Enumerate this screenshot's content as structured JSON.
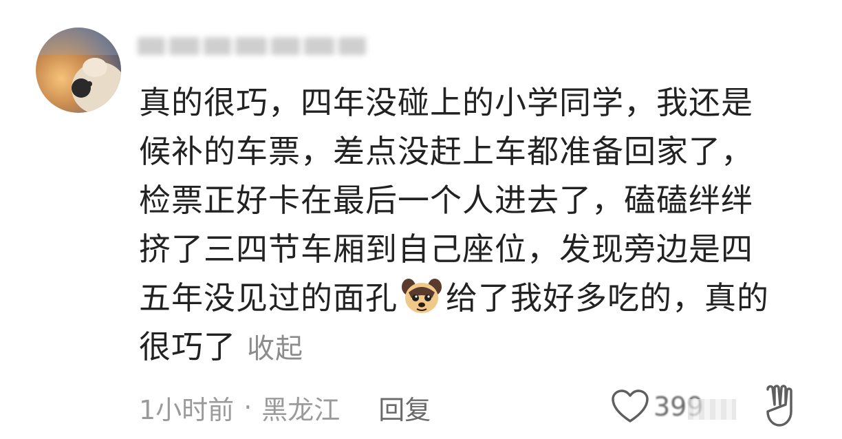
{
  "comment": {
    "lines": [
      "真的很巧，四年没碰上的小学同学，我还是",
      "候补的车票，差点没赶上车都准备回家了，",
      "检票正好卡在最后一个人进去了，磕磕绊绊",
      "挤了三四节车厢到自己座位，发现旁边是四"
    ],
    "line5_before_emoji": "五年没见过的面孔",
    "line5_after_emoji": "给了我好多吃的，真的",
    "line6": "很巧了",
    "collapse_label": "收起"
  },
  "meta": {
    "time": "1小时前",
    "separator": "·",
    "location": "黑龙江",
    "reply_label": "回复"
  },
  "actions": {
    "like_count": "399"
  },
  "colors": {
    "text": "#222222",
    "secondary": "#8c8c8c",
    "icon": "#6a6a6a"
  }
}
